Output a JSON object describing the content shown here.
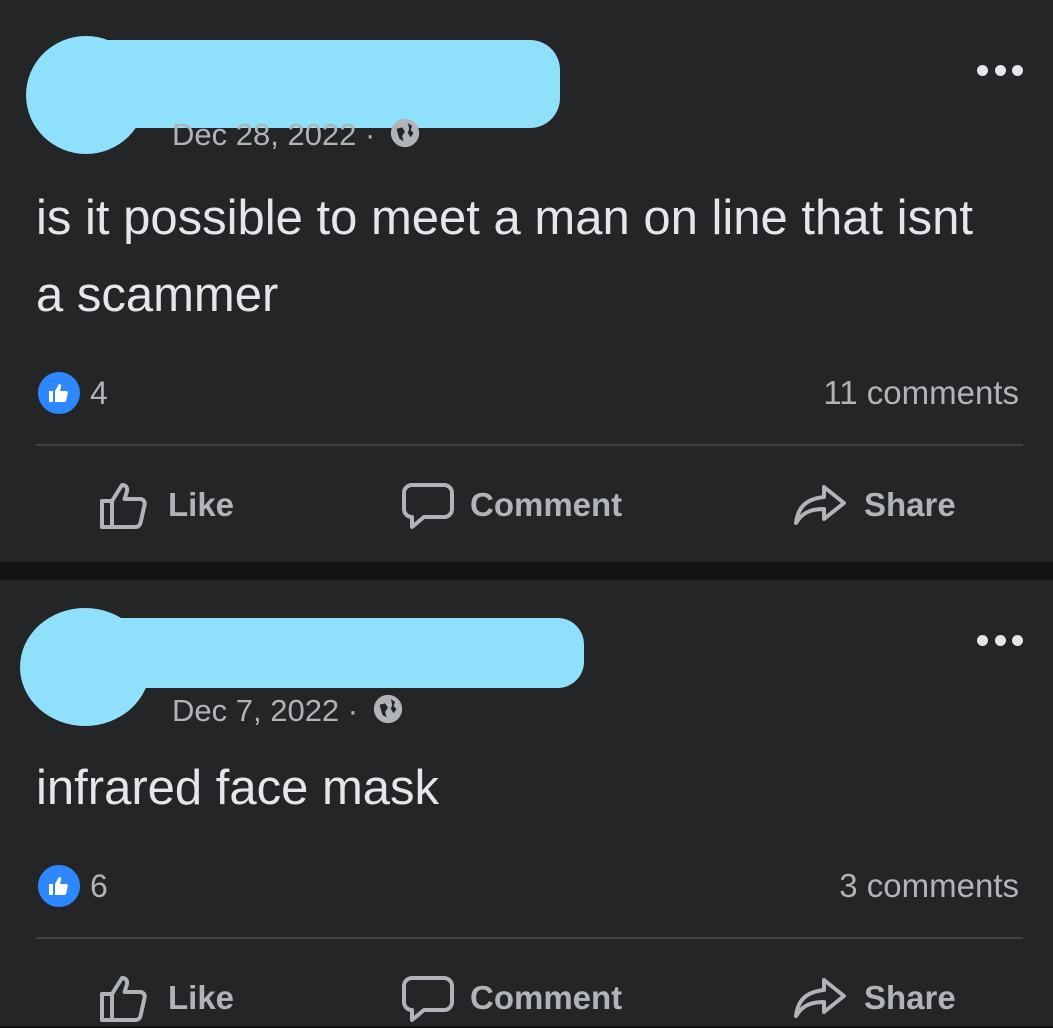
{
  "posts": [
    {
      "date": "Dec 28, 2022 ·",
      "text": "is it possible to meet a man on line that isnt a scammer",
      "like_count": "4",
      "comments_count": "11 comments",
      "actions": {
        "like": "Like",
        "comment": "Comment",
        "share": "Share"
      }
    },
    {
      "date": "Dec 7, 2022 ·",
      "text": "infrared face mask",
      "like_count": "6",
      "comments_count": "3 comments",
      "actions": {
        "like": "Like",
        "comment": "Comment",
        "share": "Share"
      }
    }
  ],
  "icons": {
    "privacy": "globe-icon",
    "menu": "more-options-icon",
    "reaction": "thumbs-up-icon",
    "like": "thumbs-up-outline-icon",
    "comment": "speech-bubble-icon",
    "share": "share-arrow-icon"
  },
  "colors": {
    "background": "#242526",
    "separator": "#121212",
    "text_primary": "#e4e6eb",
    "text_secondary": "#b0b3b8",
    "reaction_blue": "#2d88ff",
    "redaction": "#8fe0fb"
  }
}
